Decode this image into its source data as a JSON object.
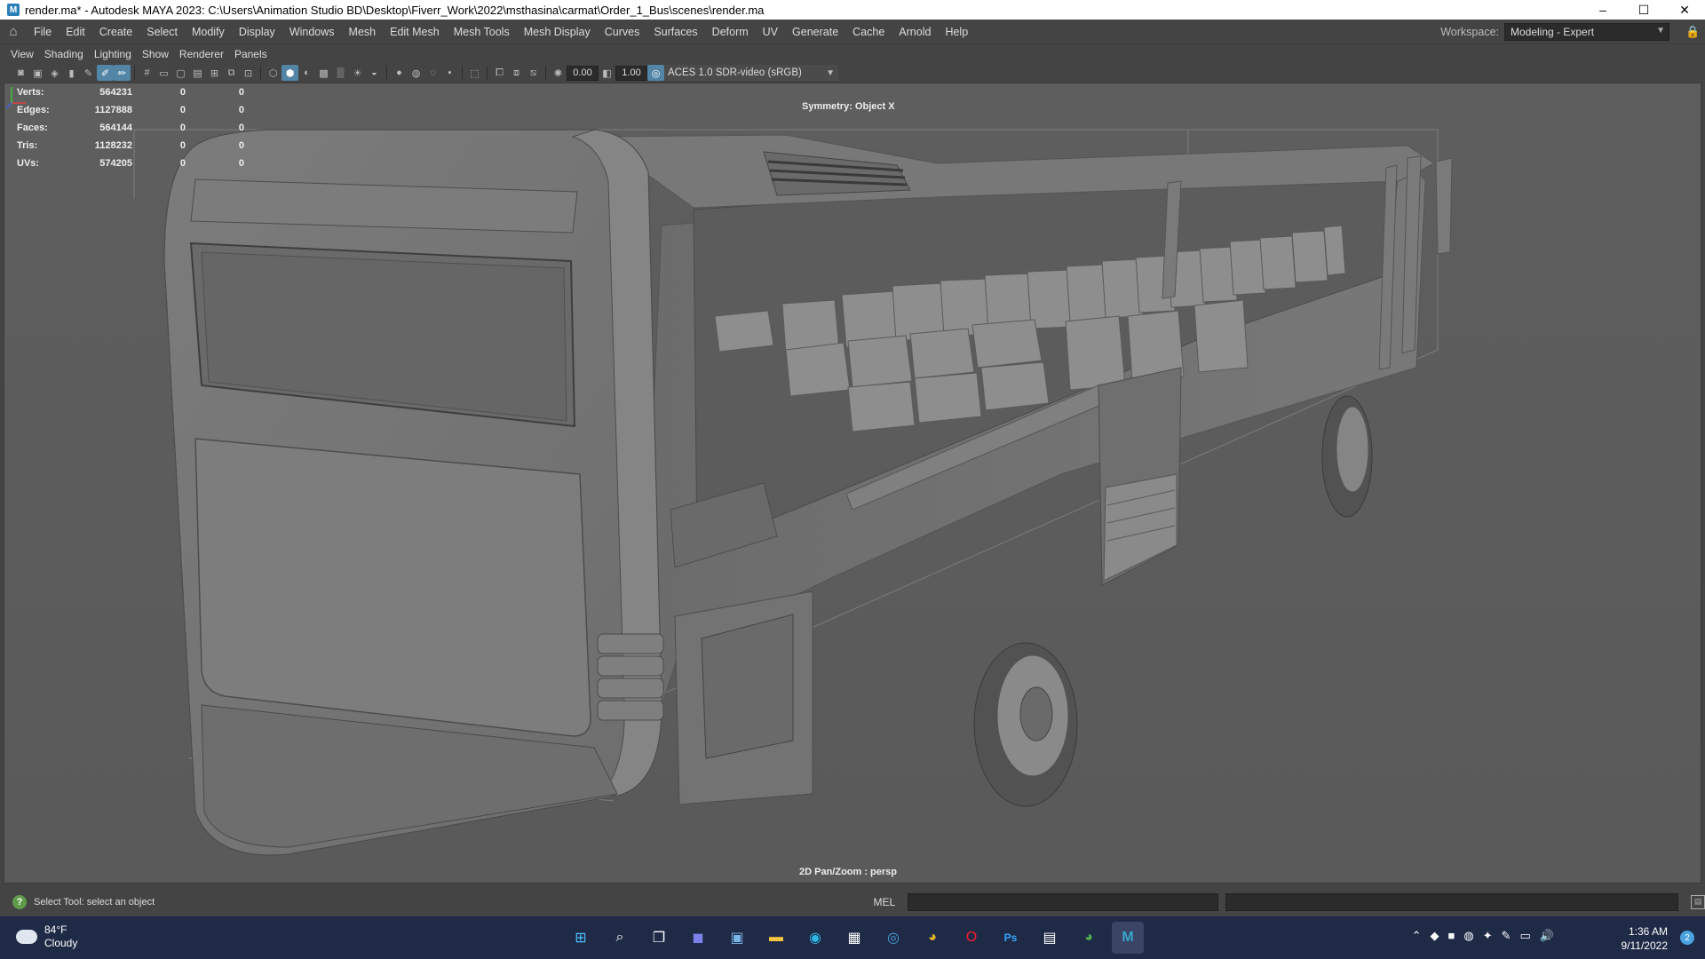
{
  "window": {
    "title": "render.ma* - Autodesk MAYA 2023: C:\\Users\\Animation Studio BD\\Desktop\\Fiverr_Work\\2022\\msthasina\\carmat\\Order_1_Bus\\scenes\\render.ma",
    "app_icon_glyph": "M",
    "minimize": "–",
    "maximize": "☐",
    "close": "✕"
  },
  "menubar": {
    "home_icon": "⌂",
    "items": [
      "File",
      "Edit",
      "Create",
      "Select",
      "Modify",
      "Display",
      "Windows",
      "Mesh",
      "Edit Mesh",
      "Mesh Tools",
      "Mesh Display",
      "Curves",
      "Surfaces",
      "Deform",
      "UV",
      "Generate",
      "Cache",
      "Arnold",
      "Help"
    ],
    "workspace_label": "Workspace:",
    "workspace_value": "Modeling - Expert",
    "lock_icon": "🔒"
  },
  "panel_menu": {
    "items": [
      "View",
      "Shading",
      "Lighting",
      "Show",
      "Renderer",
      "Panels"
    ]
  },
  "toolbar": {
    "near_clip_value": "0.00",
    "far_clip_value": "1.00",
    "color_space": "ACES 1.0 SDR-video (sRGB)"
  },
  "hud": {
    "rows": [
      {
        "label": "Verts:",
        "v1": "564231",
        "v2": "0",
        "v3": "0"
      },
      {
        "label": "Edges:",
        "v1": "1127888",
        "v2": "0",
        "v3": "0"
      },
      {
        "label": "Faces:",
        "v1": "564144",
        "v2": "0",
        "v3": "0"
      },
      {
        "label": "Tris:",
        "v1": "1128232",
        "v2": "0",
        "v3": "0"
      },
      {
        "label": "UVs:",
        "v1": "574205",
        "v2": "0",
        "v3": "0"
      }
    ],
    "symmetry": "Symmetry: Object X",
    "camera": "2D Pan/Zoom : persp"
  },
  "statusline": {
    "help_text": "Select Tool: select an object",
    "mel_label": "MEL"
  },
  "taskbar": {
    "temperature": "84°F",
    "condition": "Cloudy",
    "time": "1:36 AM",
    "date": "9/11/2022",
    "notification_count": "2",
    "apps": [
      {
        "name": "windows-start-icon",
        "glyph": "⊞",
        "color": "#4cc2ff"
      },
      {
        "name": "search-icon",
        "glyph": "⌕",
        "color": "#ffffff"
      },
      {
        "name": "task-view-icon",
        "glyph": "❐",
        "color": "#ffffff"
      },
      {
        "name": "teams-chat-icon",
        "glyph": "◼",
        "color": "#7b83eb"
      },
      {
        "name": "photos-icon",
        "glyph": "▣",
        "color": "#7ab6e8"
      },
      {
        "name": "file-explorer-icon",
        "glyph": "▬",
        "color": "#f4c542"
      },
      {
        "name": "edge-icon",
        "glyph": "◉",
        "color": "#2fb9e8"
      },
      {
        "name": "store-icon",
        "glyph": "▦",
        "color": "#ffffff"
      },
      {
        "name": "dell-icon",
        "glyph": "◎",
        "color": "#4aa3df"
      },
      {
        "name": "chrome-icon",
        "glyph": "◕",
        "color": "#e6b624"
      },
      {
        "name": "opera-icon",
        "glyph": "O",
        "color": "#ff1b2d"
      },
      {
        "name": "photoshop-icon",
        "glyph": "Ps",
        "color": "#31a8ff"
      },
      {
        "name": "calculator-icon",
        "glyph": "▤",
        "color": "#cccccc"
      },
      {
        "name": "chrome-profile-icon",
        "glyph": "◕",
        "color": "#4caf50"
      },
      {
        "name": "maya-icon",
        "glyph": "M",
        "color": "#37a5cc"
      }
    ],
    "tray_icons": [
      "⌃",
      "◆",
      "■",
      "◍",
      "✦",
      "✎",
      "▭",
      "🔊"
    ]
  }
}
